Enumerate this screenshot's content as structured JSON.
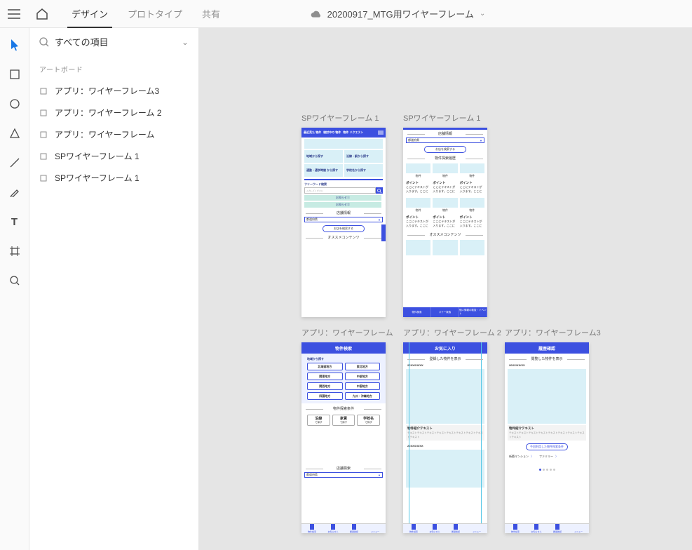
{
  "topbar": {
    "tabs": {
      "design": "デザイン",
      "prototype": "プロトタイプ",
      "share": "共有"
    },
    "doc_title": "20200917_MTG用ワイヤーフレーム"
  },
  "layers": {
    "search_placeholder": "すべての項目",
    "section_header": "アートボード",
    "items": [
      "アプリ：ワイヤーフレーム3",
      "アプリ：ワイヤーフレーム 2",
      "アプリ：ワイヤーフレーム",
      "SPワイヤーフレーム 1",
      "SPワイヤーフレーム 1"
    ]
  },
  "artboards": {
    "sp1": {
      "label": "SPワイヤーフレーム 1",
      "nav": {
        "a": "最近見た\n物件",
        "b": "検討中の\n物件",
        "c": "物件\nリクエスト"
      },
      "tiles": [
        "地域から探す",
        "沿線・駅から探す",
        "通勤・通学時間\nから探す",
        "学校名から探す"
      ],
      "freeword_label": "フリーワード検索",
      "freeword_placeholder": "入力してください",
      "notices": [
        "お知らせ①",
        "お知らせ②"
      ],
      "store_section": "店舗情報",
      "store_select": "都道府県",
      "store_btn": "お店を検索する",
      "rec_section": "オススメコンテンツ"
    },
    "sp2": {
      "label": "SPワイヤーフレーム 1",
      "store_section": "店舗情報",
      "store_select": "都道府県",
      "store_btn": "お店を検索する",
      "detail_section": "物件探索履歴",
      "cell": "物件",
      "point": "ポイント",
      "point_desc": "ここにテキストが入ります。ここに",
      "rec_section": "オススメコンテンツ",
      "bottom": [
        "物件検索",
        "パナー検索",
        "個人情報の取扱・イベント"
      ]
    },
    "app1": {
      "label": "アプリ：ワイヤーフレーム",
      "header": "物件検索",
      "sub1": "地域から探す",
      "regions": [
        "北海道地方",
        "東北地方",
        "関東地方",
        "中部地方",
        "関西地方",
        "中国地方",
        "四国地方",
        "九州・沖縄地方"
      ],
      "sub2": "物件探索条件",
      "conds": [
        [
          "沿線",
          "で探す"
        ],
        [
          "家賃",
          "で探す"
        ],
        [
          "学校名",
          "で探す"
        ]
      ],
      "store_section": "店舗検索",
      "store_select": "都道府県",
      "tabs": [
        "物件検索",
        "お知らせ人",
        "履歴確認",
        "メニュー"
      ]
    },
    "app2": {
      "label": "アプリ：ワイヤーフレーム 2",
      "header": "お気に入り",
      "sub": "登録した物件を表示",
      "date": "20XX/XX/XX",
      "desc_title": "物件紹介テキスト",
      "desc_body": "テキストテキストテキストテキストテキストテキストテキストテキストテキスト",
      "tabs": [
        "物件検索",
        "お知らせ人",
        "履歴確認",
        "メニュー"
      ]
    },
    "app3": {
      "label": "アプリ：ワイヤーフレーム3",
      "header": "履歴確認",
      "sub": "閲覧した物件を表示",
      "date": "20XX/XX/XX",
      "desc_title": "物件紹介テキスト",
      "desc_body": "テキストテキストテキストテキストテキストテキストテキストテキストテキスト",
      "pill": "今回利用した物件探索条件",
      "tags": [
        "新築マンション",
        "ファミリー"
      ],
      "tabs": [
        "物件検索",
        "お知らせ人",
        "履歴確認",
        "メニュー"
      ]
    }
  }
}
